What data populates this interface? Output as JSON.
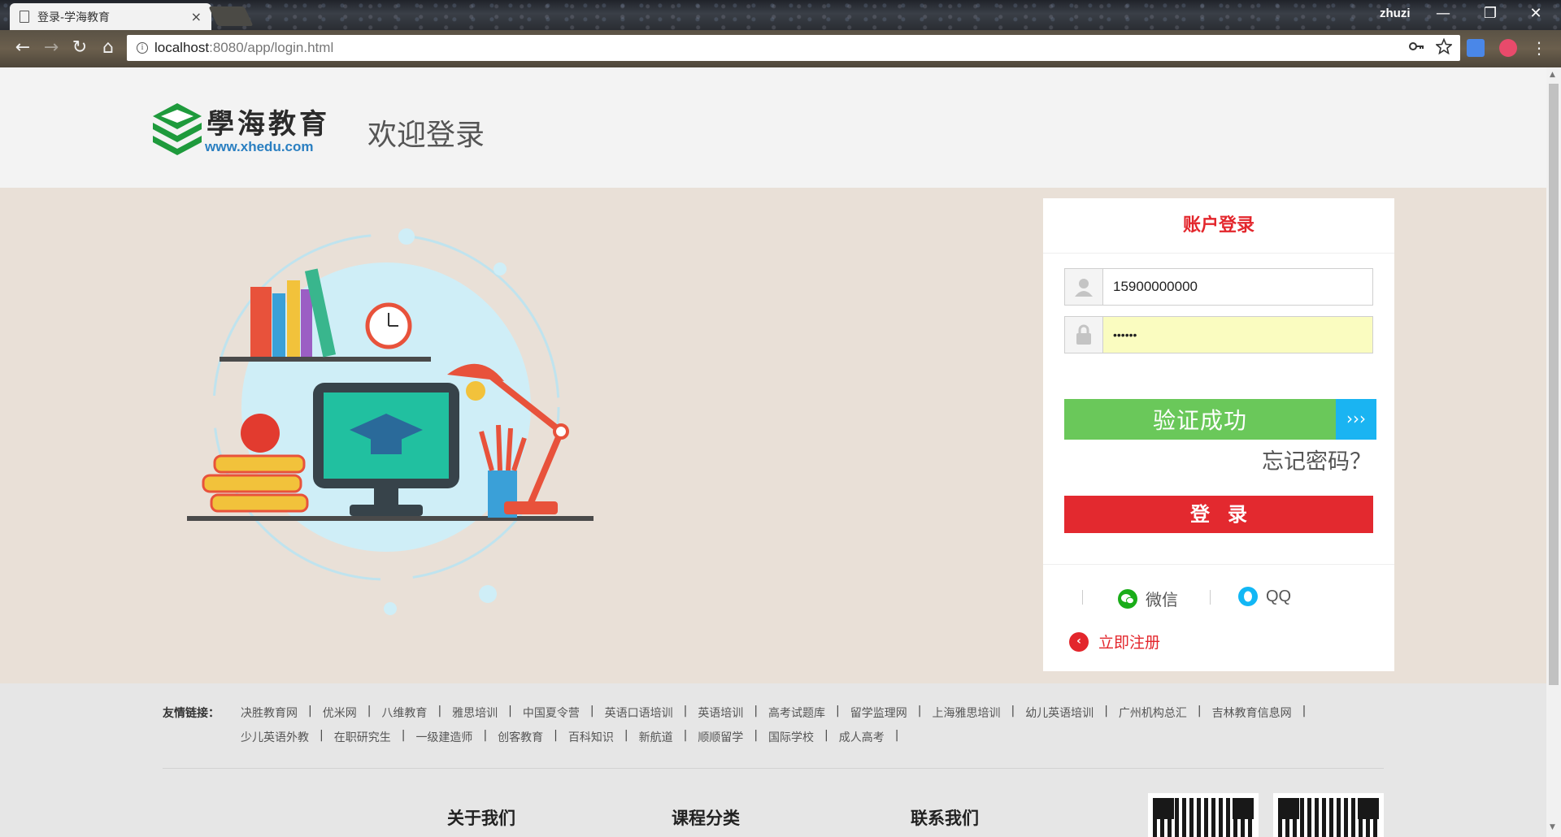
{
  "browser": {
    "tab_title": "登录-学海教育",
    "tab_close": "×",
    "profile_name": "zhuzi",
    "url_host": "localhost",
    "url_rest": ":8080/app/login.html",
    "controls": {
      "minimize": "—",
      "restore": "❐",
      "close": "✕"
    },
    "nav": {
      "back": "←",
      "forward": "→",
      "reload": "↻",
      "home": "⌂"
    }
  },
  "header": {
    "logo_text": "學海教育",
    "logo_url": "www.xhedu.com",
    "welcome": "欢迎登录"
  },
  "login": {
    "title": "账户登录",
    "username_value": "15900000000",
    "password_value": "••••••",
    "verify_text": "验证成功",
    "verify_handle": "›››",
    "forgot": "忘记密码？",
    "submit": "登录",
    "wechat": "微信",
    "qq": "QQ",
    "register": "立即注册"
  },
  "footer": {
    "links_label": "友情链接：",
    "links_row1": [
      "决胜教育网",
      "优米网",
      "八维教育",
      "雅思培训",
      "中国夏令营",
      "英语口语培训",
      "英语培训",
      "高考试题库",
      "留学监理网",
      "上海雅思培训",
      "幼儿英语培训",
      "广州机构总汇",
      "吉林教育信息网"
    ],
    "links_row2": [
      "少儿英语外教",
      "在职研究生",
      "一级建造师",
      "创客教育",
      "百科知识",
      "新航道",
      "顺顺留学",
      "国际学校",
      "成人高考"
    ],
    "columns": [
      "关于我们",
      "课程分类",
      "联系我们"
    ]
  },
  "colors": {
    "brand_red": "#e3262c",
    "success_green": "#6ac85a",
    "handle_blue": "#1ab4f2",
    "banner_bg": "#e9e0d7"
  }
}
